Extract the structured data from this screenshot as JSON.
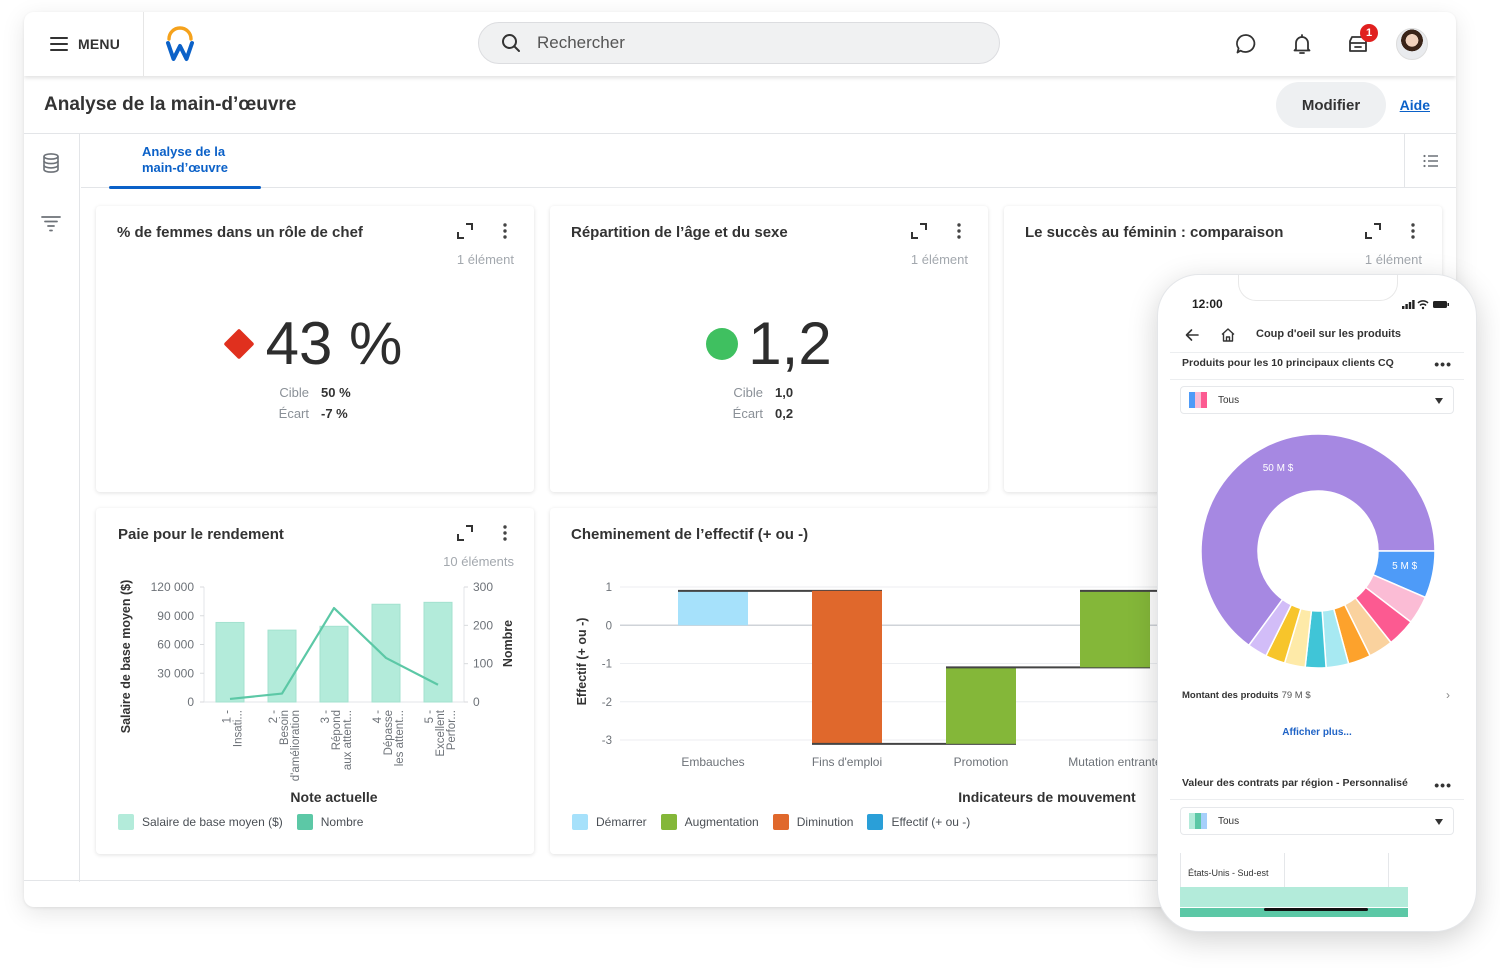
{
  "topbar": {
    "menu_label": "MENU",
    "search_placeholder": "Rechercher",
    "notification_badge": "1",
    "icons": [
      "menu-icon",
      "workday-logo",
      "search-icon",
      "chat-icon",
      "bell-icon",
      "inbox-icon",
      "avatar"
    ]
  },
  "page": {
    "title": "Analyse de la main-d’œuvre",
    "modifier_label": "Modifier",
    "aide_label": "Aide"
  },
  "leftrail": {
    "icons": [
      "database-icon",
      "filter-icon"
    ]
  },
  "tabs": [
    {
      "label_line1": "Analyse de la",
      "label_line2": "main-d’œuvre",
      "active": true
    }
  ],
  "colors": {
    "accent": "#0b61c8",
    "kpi_bad": "#e0301e",
    "kpi_good": "#3fc060",
    "bar_mint": "#b3ebda",
    "line_mint": "#5cc8a6",
    "start": "#a6e1fb",
    "increase": "#84b739",
    "decrease": "#e0682c",
    "total": "#2a9fd8"
  },
  "cards": {
    "women_leaders": {
      "title": "% de femmes dans un rôle de chef",
      "count": "1 élément",
      "value": "43 %",
      "status": "below-target",
      "target_label": "Cible",
      "target": "50 %",
      "gap_label": "Écart",
      "gap": "-7 %"
    },
    "age_gender": {
      "title": "Répartition de l’âge et du sexe",
      "count": "1 élément",
      "value": "1,2",
      "status": "on-target",
      "target_label": "Cible",
      "target": "1,0",
      "gap_label": "Écart",
      "gap": "0,2"
    },
    "women_success": {
      "title": "Le succès au féminin : comparaison",
      "count": "1 élément"
    },
    "pay_performance": {
      "title": "Paie pour le rendement",
      "count": "10 éléments"
    },
    "headcount_flow": {
      "title": "Cheminement de l’effectif (+ ou -)"
    }
  },
  "chart_data": [
    {
      "type": "bar",
      "title": "Paie pour le rendement",
      "categories": [
        [
          "1 -",
          "Insati..."
        ],
        [
          "2 -",
          "Besoin",
          "d'amélioration"
        ],
        [
          "3 -",
          "Répond",
          "aux attent..."
        ],
        [
          "4 -",
          "Dépasse",
          "les attent..."
        ],
        [
          "5 -",
          "Excellent",
          "Perfor..."
        ]
      ],
      "series": [
        {
          "name": "Salaire de base moyen ($)",
          "kind": "bar",
          "axis": "left",
          "values": [
            83000,
            75000,
            79000,
            102000,
            104000
          ]
        },
        {
          "name": "Nombre",
          "kind": "line",
          "axis": "right",
          "values": [
            8,
            22,
            245,
            115,
            45
          ]
        }
      ],
      "xlabel": "Note actuelle",
      "ylabel": "Salaire de base moyen ($)",
      "y2label": "Nombre",
      "ylim": [
        0,
        120000
      ],
      "yticks": [
        "0",
        "30 000",
        "60 000",
        "90 000",
        "120 000"
      ],
      "y2lim": [
        0,
        300
      ],
      "y2ticks": [
        "0",
        "100",
        "200",
        "300"
      ],
      "legend": [
        "Salaire de base moyen ($)",
        "Nombre"
      ],
      "legend_position": "bottom-left"
    },
    {
      "type": "bar",
      "subtype": "waterfall",
      "title": "Cheminement de l’effectif (+ ou -)",
      "categories": [
        "Embauches",
        "Fins d'emploi",
        "Promotion",
        "Mutation entrante"
      ],
      "steps": [
        {
          "category": "Embauches",
          "kind": "Démarrer",
          "from": 0,
          "to": 0.9
        },
        {
          "category": "Fins d'emploi",
          "kind": "Diminution",
          "from": 0.9,
          "to": -3.1
        },
        {
          "category": "Promotion",
          "kind": "Augmentation",
          "from": -3.1,
          "to": -1.1
        },
        {
          "category": "Mutation entrante",
          "kind": "Augmentation",
          "from": -1.1,
          "to": 0.9
        }
      ],
      "xlabel": "Indicateurs de mouvement",
      "ylabel": "Effectif (+ ou -)",
      "ylim": [
        -3,
        1
      ],
      "yticks": [
        "1",
        "0",
        "-1",
        "-2",
        "-3"
      ],
      "legend": [
        "Démarrer",
        "Augmentation",
        "Diminution",
        "Effectif (+ ou -)"
      ],
      "legend_position": "bottom-left",
      "grid": true
    },
    {
      "type": "pie",
      "subtype": "donut",
      "title": "Produits pour les 10 principaux clients CQ",
      "slices": [
        {
          "label": "50 M $",
          "value": 50,
          "color": "#a688e2"
        },
        {
          "label": "5 M $",
          "value": 5,
          "color": "#4e9bf8"
        },
        {
          "label": "",
          "value": 3,
          "color": "#fbbcd5"
        },
        {
          "label": "",
          "value": 3,
          "color": "#fc5a91"
        },
        {
          "label": "",
          "value": 2.6,
          "color": "#fad29e"
        },
        {
          "label": "",
          "value": 2.4,
          "color": "#fda22c"
        },
        {
          "label": "",
          "value": 2.4,
          "color": "#a7e9f2"
        },
        {
          "label": "",
          "value": 2.2,
          "color": "#40c5d7"
        },
        {
          "label": "",
          "value": 2.2,
          "color": "#feeaa8"
        },
        {
          "label": "",
          "value": 2.1,
          "color": "#f7c52b"
        },
        {
          "label": "",
          "value": 2.1,
          "color": "#d2bdf8"
        }
      ],
      "total_label": "Montant des produits",
      "total_value": "79 M $"
    }
  ],
  "phone": {
    "time": "12:00",
    "nav_title": "Coup d'oeil sur les produits",
    "section1_title": "Produits pour les 10 principaux clients CQ",
    "filter1": "Tous",
    "amount_label": "Montant des produits",
    "amount_value": "79 M $",
    "show_more": "Afficher plus...",
    "section2_title": "Valeur des contrats par région - Personnalisé",
    "filter2": "Tous",
    "region_label": "États-Unis - Sud-est"
  }
}
